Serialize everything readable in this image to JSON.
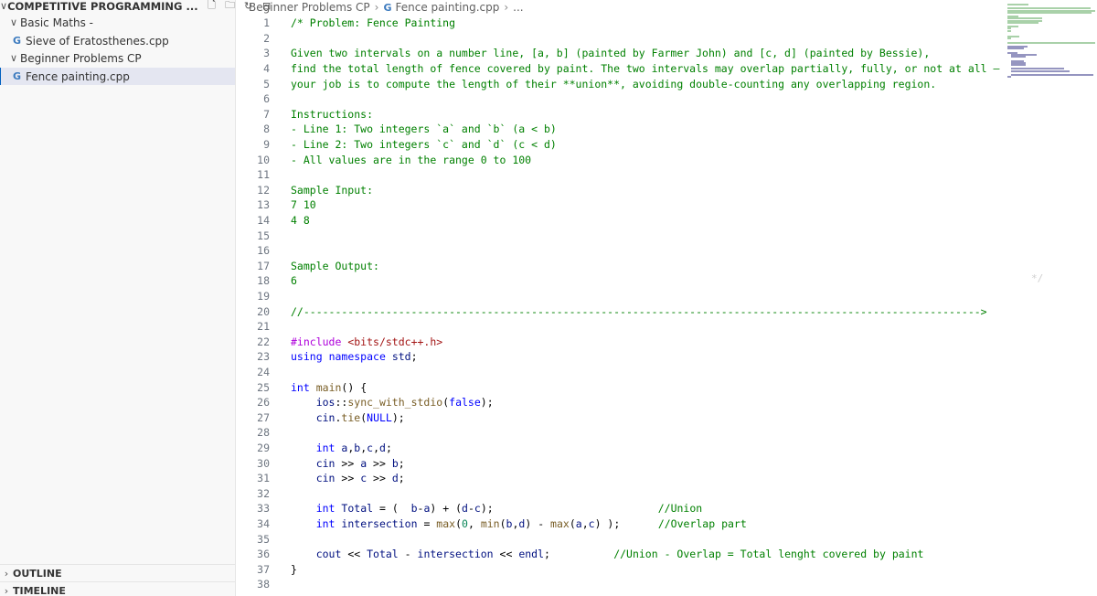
{
  "sidebar": {
    "root_label": "COMPETITIVE PROGRAMMING ...",
    "items": [
      {
        "label": "Basic Maths -"
      },
      {
        "label": "Sieve of Eratosthenes.cpp"
      },
      {
        "label": "Beginner Problems CP"
      },
      {
        "label": "Fence painting.cpp"
      }
    ],
    "outline_label": "OUTLINE",
    "timeline_label": "TIMELINE"
  },
  "breadcrumb": {
    "folder": "Beginner Problems CP",
    "file": "Fence painting.cpp",
    "more": "..."
  },
  "editor": {
    "lines": [
      "/* Problem: Fence Painting",
      "",
      "Given two intervals on a number line, [a, b] (painted by Farmer John) and [c, d] (painted by Bessie),",
      "find the total length of fence covered by paint. The two intervals may overlap partially, fully, or not at all —",
      "your job is to compute the length of their **union**, avoiding double-counting any overlapping region.",
      "",
      "Instructions:",
      "- Line 1: Two integers `a` and `b` (a < b)",
      "- Line 2: Two integers `c` and `d` (c < d)",
      "- All values are in the range 0 to 100",
      "",
      "Sample Input:",
      "7 10",
      "4 8",
      "",
      "",
      "Sample Output:",
      "6",
      "",
      "//----------------------------------------------------------------------------------------------------------->",
      "",
      "#include <bits/stdc++.h>",
      "using namespace std;",
      "",
      "int main() {",
      "    ios::sync_with_stdio(false);",
      "    cin.tie(NULL);",
      "",
      "    int a,b,c,d;",
      "    cin >> a >> b;",
      "    cin >> c >> d;",
      "",
      "    int Total = (  b-a) + (d-c);                          //Union",
      "    int intersection = max(0, min(b,d) - max(a,c) );      //Overlap part",
      "",
      "    cout << Total - intersection << endl;          //Union - Overlap = Total lenght covered by paint",
      "}",
      ""
    ],
    "faded_comment_end": "*/"
  }
}
